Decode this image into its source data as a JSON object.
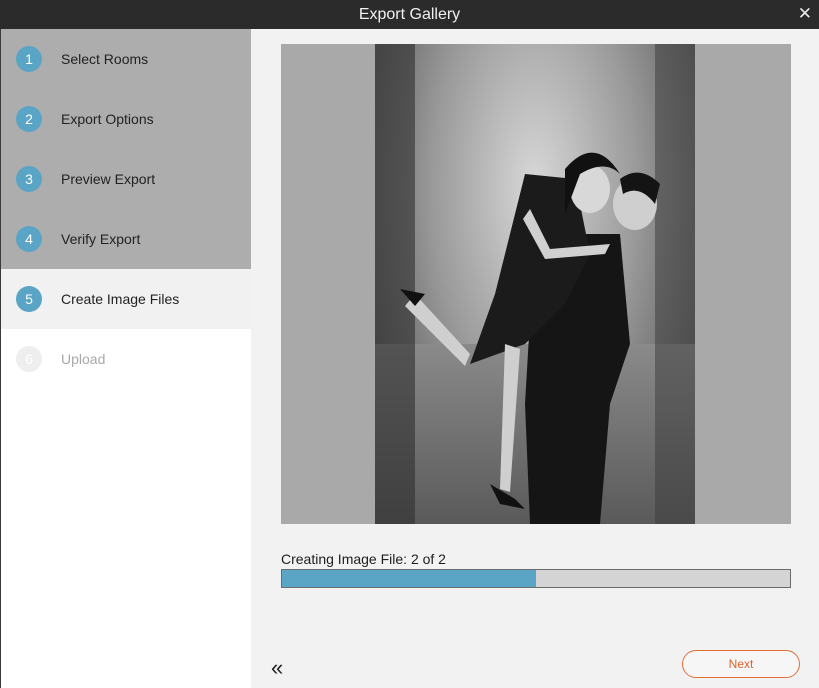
{
  "window": {
    "title": "Export Gallery",
    "close_icon": "close-icon"
  },
  "steps": [
    {
      "number": "1",
      "label": "Select Rooms",
      "state": "done"
    },
    {
      "number": "2",
      "label": "Export Options",
      "state": "done"
    },
    {
      "number": "3",
      "label": "Preview Export",
      "state": "done"
    },
    {
      "number": "4",
      "label": "Verify Export",
      "state": "done"
    },
    {
      "number": "5",
      "label": "Create Image Files",
      "state": "current"
    },
    {
      "number": "6",
      "label": "Upload",
      "state": "future"
    }
  ],
  "main": {
    "status": "Creating Image File: 2 of 2",
    "progress_fraction": 0.5,
    "back_icon": "double-chevron-left-icon",
    "next_label": "Next"
  },
  "colors": {
    "accent": "#5aa5c6",
    "next_border": "#e0703a",
    "titlebar": "#2b2b2b"
  }
}
